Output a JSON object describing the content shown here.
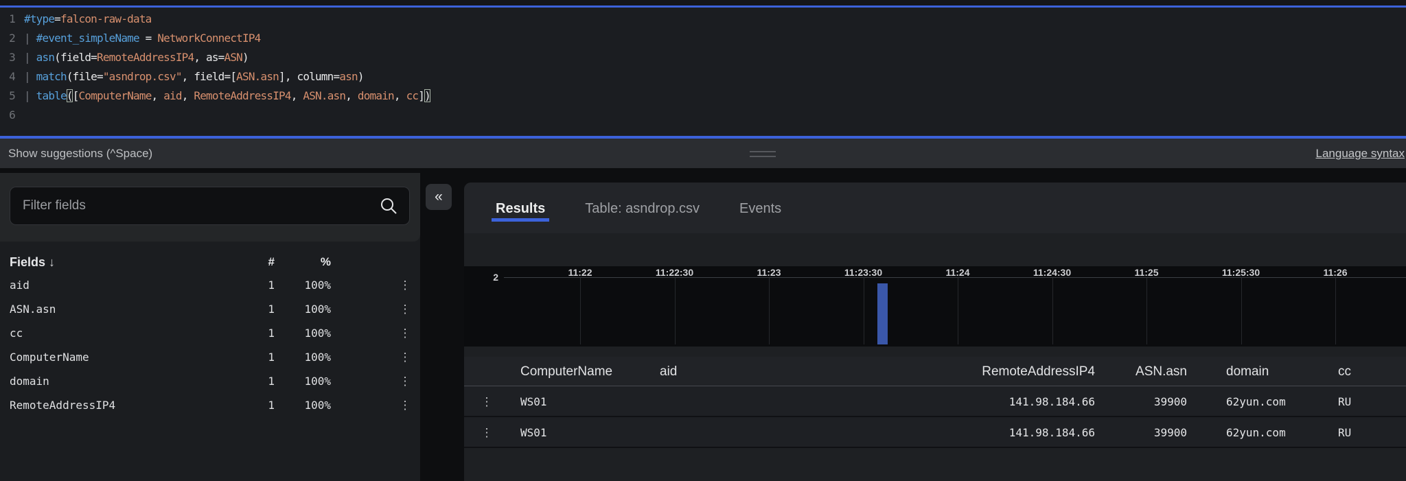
{
  "colors": {
    "accent_blue": "#3c62da",
    "bar_blue": "#3a57a9",
    "syntax_function": "#57a0db",
    "syntax_value": "#d8906e",
    "syntax_plain": "#e8e9ea",
    "syntax_pipe": "#70737a"
  },
  "editor": {
    "lines": [
      {
        "num": "1",
        "tokens": [
          {
            "t": "#type",
            "c": "fn"
          },
          {
            "t": "=",
            "c": "pun"
          },
          {
            "t": "falcon-raw-data",
            "c": "val"
          }
        ]
      },
      {
        "num": "2",
        "tokens": [
          {
            "t": "| ",
            "c": "pipe"
          },
          {
            "t": "#event_simpleName",
            "c": "fn"
          },
          {
            "t": " = ",
            "c": "pun"
          },
          {
            "t": "NetworkConnectIP4",
            "c": "val"
          }
        ]
      },
      {
        "num": "3",
        "tokens": [
          {
            "t": "| ",
            "c": "pipe"
          },
          {
            "t": "asn",
            "c": "fn"
          },
          {
            "t": "(field=",
            "c": "pun"
          },
          {
            "t": "RemoteAddressIP4",
            "c": "val"
          },
          {
            "t": ", as=",
            "c": "pun"
          },
          {
            "t": "ASN",
            "c": "val"
          },
          {
            "t": ")",
            "c": "pun"
          }
        ]
      },
      {
        "num": "4",
        "tokens": [
          {
            "t": "| ",
            "c": "pipe"
          },
          {
            "t": "match",
            "c": "fn"
          },
          {
            "t": "(file=",
            "c": "pun"
          },
          {
            "t": "\"asndrop.csv\"",
            "c": "val"
          },
          {
            "t": ", field=[",
            "c": "pun"
          },
          {
            "t": "ASN.asn",
            "c": "val"
          },
          {
            "t": "], column=",
            "c": "pun"
          },
          {
            "t": "asn",
            "c": "val"
          },
          {
            "t": ")",
            "c": "pun"
          }
        ]
      },
      {
        "num": "5",
        "tokens": [
          {
            "t": "| ",
            "c": "pipe"
          },
          {
            "t": "table",
            "c": "fn"
          },
          {
            "t": "(",
            "c": "box"
          },
          {
            "t": "[",
            "c": "pun"
          },
          {
            "t": "ComputerName",
            "c": "val"
          },
          {
            "t": ", ",
            "c": "pun"
          },
          {
            "t": "aid",
            "c": "val"
          },
          {
            "t": ", ",
            "c": "pun"
          },
          {
            "t": "RemoteAddressIP4",
            "c": "val"
          },
          {
            "t": ", ",
            "c": "pun"
          },
          {
            "t": "ASN.asn",
            "c": "val"
          },
          {
            "t": ", ",
            "c": "pun"
          },
          {
            "t": "domain",
            "c": "val"
          },
          {
            "t": ", ",
            "c": "pun"
          },
          {
            "t": "cc",
            "c": "val"
          },
          {
            "t": "]",
            "c": "pun"
          },
          {
            "t": ")",
            "c": "box"
          }
        ]
      },
      {
        "num": "6",
        "tokens": []
      }
    ]
  },
  "status_bar": {
    "suggestions_hint": "Show suggestions (^Space)",
    "syntax_link": "Language syntax"
  },
  "sidebar": {
    "filter_placeholder": "Filter fields",
    "collapse_icon": "«",
    "header": {
      "title": "Fields",
      "sort_icon": "↓",
      "count": "#",
      "percent": "%"
    },
    "kebab_icon": "⋮",
    "fields": [
      {
        "name": "aid",
        "count": "1",
        "percent": "100%"
      },
      {
        "name": "ASN.asn",
        "count": "1",
        "percent": "100%"
      },
      {
        "name": "cc",
        "count": "1",
        "percent": "100%"
      },
      {
        "name": "ComputerName",
        "count": "1",
        "percent": "100%"
      },
      {
        "name": "domain",
        "count": "1",
        "percent": "100%"
      },
      {
        "name": "RemoteAddressIP4",
        "count": "1",
        "percent": "100%"
      }
    ]
  },
  "tabs": [
    {
      "label": "Results",
      "active": true
    },
    {
      "label": "Table: asndrop.csv",
      "active": false
    },
    {
      "label": "Events",
      "active": false
    }
  ],
  "chart_data": {
    "type": "bar",
    "title": "",
    "x_ticks": [
      "11:22",
      "11:22:30",
      "11:23",
      "11:23:30",
      "11:24",
      "11:24:30",
      "11:25",
      "11:25:30",
      "11:26"
    ],
    "y_axis_tick": "2",
    "ylim": [
      0,
      2
    ],
    "grid": true,
    "bars": [
      {
        "x": "11:23:35",
        "value": 2
      }
    ],
    "bar_color": "#3a57a9"
  },
  "results_table": {
    "columns": [
      "ComputerName",
      "aid",
      "RemoteAddressIP4",
      "ASN.asn",
      "domain",
      "cc"
    ],
    "rows": [
      [
        "WS01",
        "",
        "141.98.184.66",
        "39900",
        "62yun.com",
        "RU"
      ],
      [
        "WS01",
        "",
        "141.98.184.66",
        "39900",
        "62yun.com",
        "RU"
      ]
    ]
  }
}
